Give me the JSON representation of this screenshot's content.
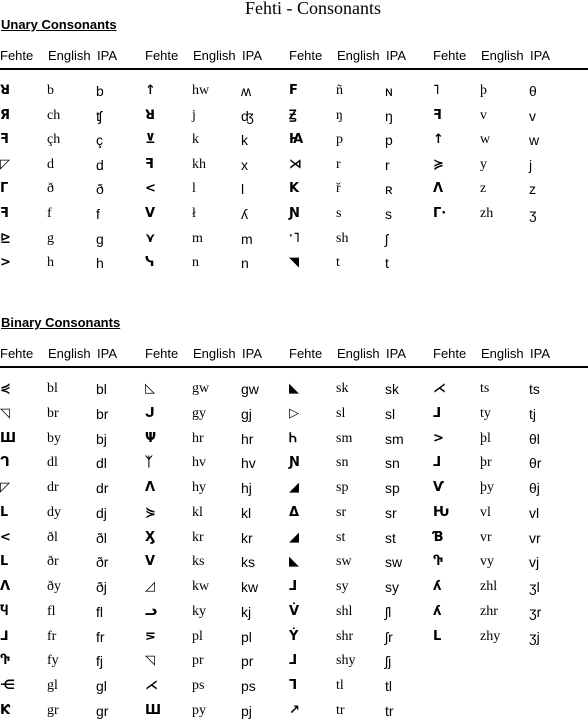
{
  "title": "Fehti - Consonants",
  "headers": {
    "fehte": "Fehte",
    "english": "English",
    "ipa": "IPA"
  },
  "unary": {
    "heading": "Unary Consonants",
    "columns": [
      [
        {
          "glyph": "ꓤ",
          "english": "b",
          "ipa": "b"
        },
        {
          "glyph": "Я",
          "english": "ch",
          "ipa": "ʧ"
        },
        {
          "glyph": "ꟻ",
          "english": "çh",
          "ipa": "ç"
        },
        {
          "glyph": "◸",
          "english": "d",
          "ipa": "d"
        },
        {
          "glyph": "Γ",
          "english": "ð",
          "ipa": "ð"
        },
        {
          "glyph": "ꟻ",
          "english": "f",
          "ipa": "f"
        },
        {
          "glyph": "⊵",
          "english": "g",
          "ipa": "g"
        },
        {
          "glyph": ">",
          "english": "h",
          "ipa": "h"
        }
      ],
      [
        {
          "glyph": "↑",
          "english": "hw",
          "ipa": "ʍ"
        },
        {
          "glyph": "ꓤ",
          "english": "j",
          "ipa": "ʤ"
        },
        {
          "glyph": "⊻",
          "english": "k",
          "ipa": "k"
        },
        {
          "glyph": "ꟻ",
          "english": "kh",
          "ipa": "x"
        },
        {
          "glyph": "<",
          "english": "l",
          "ipa": "l"
        },
        {
          "glyph": "V",
          "english": "ł",
          "ipa": "ʎ"
        },
        {
          "glyph": "⋎",
          "english": "m",
          "ipa": "m"
        },
        {
          "glyph": "ᓭ",
          "english": "n",
          "ipa": "n"
        }
      ],
      [
        {
          "glyph": "Ϝ",
          "english": "ñ",
          "ipa": "ɴ"
        },
        {
          "glyph": "Ꙃ",
          "english": "ŋ",
          "ipa": "ŋ"
        },
        {
          "glyph": "Ꙗ",
          "english": "p",
          "ipa": "p"
        },
        {
          "glyph": "⋊",
          "english": "r",
          "ipa": "r"
        },
        {
          "glyph": "K",
          "english": "ř",
          "ipa": "ʀ"
        },
        {
          "glyph": "Ɲ",
          "english": "s",
          "ipa": "s"
        },
        {
          "glyph": "ˑ˥",
          "english": "sh",
          "ipa": "ʃ"
        },
        {
          "glyph": "◥",
          "english": "t",
          "ipa": "t"
        }
      ],
      [
        {
          "glyph": "˥",
          "english": "þ",
          "ipa": "θ"
        },
        {
          "glyph": "ꟻ",
          "english": "v",
          "ipa": "v"
        },
        {
          "glyph": "↑",
          "english": "w",
          "ipa": "w"
        },
        {
          "glyph": "≽",
          "english": "y",
          "ipa": "j"
        },
        {
          "glyph": "Ʌ",
          "english": "z",
          "ipa": "z"
        },
        {
          "glyph": "Γ·",
          "english": "zh",
          "ipa": "ʒ"
        }
      ]
    ]
  },
  "binary": {
    "heading": "Binary Consonants",
    "columns": [
      [
        {
          "glyph": "⋞",
          "english": "bl",
          "ipa": "bl"
        },
        {
          "glyph": "◹",
          "english": "br",
          "ipa": "br"
        },
        {
          "glyph": "Ш",
          "english": "by",
          "ipa": "bj"
        },
        {
          "glyph": "ᒉ",
          "english": "dl",
          "ipa": "dl"
        },
        {
          "glyph": "◸",
          "english": "dr",
          "ipa": "dr"
        },
        {
          "glyph": "ᒪ",
          "english": "dy",
          "ipa": "dj"
        },
        {
          "glyph": "<",
          "english": "ðl",
          "ipa": "ðl"
        },
        {
          "glyph": "ᒪ",
          "english": "ðr",
          "ipa": "ðr"
        },
        {
          "glyph": "Λ",
          "english": "ðy",
          "ipa": "ðj"
        },
        {
          "glyph": "Ⴏ",
          "english": "fl",
          "ipa": "fl"
        },
        {
          "glyph": "⅃",
          "english": "fr",
          "ipa": "fr"
        },
        {
          "glyph": "Ⴅ",
          "english": "fy",
          "ipa": "fj"
        },
        {
          "glyph": "⋲",
          "english": "gl",
          "ipa": "gl"
        },
        {
          "glyph": "Ƙ",
          "english": "gr",
          "ipa": "gr"
        }
      ],
      [
        {
          "glyph": "◺",
          "english": "gw",
          "ipa": "gw"
        },
        {
          "glyph": "ᒍ",
          "english": "gy",
          "ipa": "gj"
        },
        {
          "glyph": "Ψ",
          "english": "hr",
          "ipa": "hr"
        },
        {
          "glyph": "ᛉ",
          "english": "hv",
          "ipa": "hv"
        },
        {
          "glyph": "Λ",
          "english": "hy",
          "ipa": "hj"
        },
        {
          "glyph": "⋟",
          "english": "kl",
          "ipa": "kl"
        },
        {
          "glyph": "Ӽ",
          "english": "kr",
          "ipa": "kr"
        },
        {
          "glyph": "V",
          "english": "ks",
          "ipa": "ks"
        },
        {
          "glyph": "◿",
          "english": "kw",
          "ipa": "kw"
        },
        {
          "glyph": "ᓗ",
          "english": "ky",
          "ipa": "kj"
        },
        {
          "glyph": "⋝",
          "english": "pl",
          "ipa": "pl"
        },
        {
          "glyph": "◹",
          "english": "pr",
          "ipa": "pr"
        },
        {
          "glyph": "⋌",
          "english": "ps",
          "ipa": "ps"
        },
        {
          "glyph": "Ш",
          "english": "py",
          "ipa": "pj"
        }
      ],
      [
        {
          "glyph": "◣",
          "english": "sk",
          "ipa": "sk"
        },
        {
          "glyph": "▷",
          "english": "sl",
          "ipa": "sl"
        },
        {
          "glyph": "Ꮒ",
          "english": "sm",
          "ipa": "sm"
        },
        {
          "glyph": "Ɲ",
          "english": "sn",
          "ipa": "sn"
        },
        {
          "glyph": "◢",
          "english": "sp",
          "ipa": "sp"
        },
        {
          "glyph": "Δ",
          "english": "sr",
          "ipa": "sr"
        },
        {
          "glyph": "◢",
          "english": "st",
          "ipa": "st"
        },
        {
          "glyph": "◣",
          "english": "sw",
          "ipa": "sw"
        },
        {
          "glyph": "ᒧ",
          "english": "sy",
          "ipa": "sy"
        },
        {
          "glyph": "V̇",
          "english": "shl",
          "ipa": "ʃl"
        },
        {
          "glyph": "Ẏ",
          "english": "shr",
          "ipa": "ʃr"
        },
        {
          "glyph": "ᒧ",
          "english": "shy",
          "ipa": "ʃj"
        },
        {
          "glyph": "ᒣ",
          "english": "tl",
          "ipa": "tl"
        },
        {
          "glyph": "↗",
          "english": "tr",
          "ipa": "tr"
        }
      ],
      [
        {
          "glyph": "⋌",
          "english": "ts",
          "ipa": "ts"
        },
        {
          "glyph": "ᒧ",
          "english": "ty",
          "ipa": "tj"
        },
        {
          "glyph": ">",
          "english": "þl",
          "ipa": "θl"
        },
        {
          "glyph": "ᒧ",
          "english": "þr",
          "ipa": "θr"
        },
        {
          "glyph": "Ѵ",
          "english": "þy",
          "ipa": "θj"
        },
        {
          "glyph": "Ƕ",
          "english": "vl",
          "ipa": "vl"
        },
        {
          "glyph": "Ɓ",
          "english": "vr",
          "ipa": "vr"
        },
        {
          "glyph": "Ⴅ",
          "english": "vy",
          "ipa": "vj"
        },
        {
          "glyph": "ʎ",
          "english": "zhl",
          "ipa": "ʒl"
        },
        {
          "glyph": "ʎ",
          "english": "zhr",
          "ipa": "ʒr"
        },
        {
          "glyph": "L",
          "english": "zhy",
          "ipa": "ʒj"
        }
      ]
    ]
  }
}
